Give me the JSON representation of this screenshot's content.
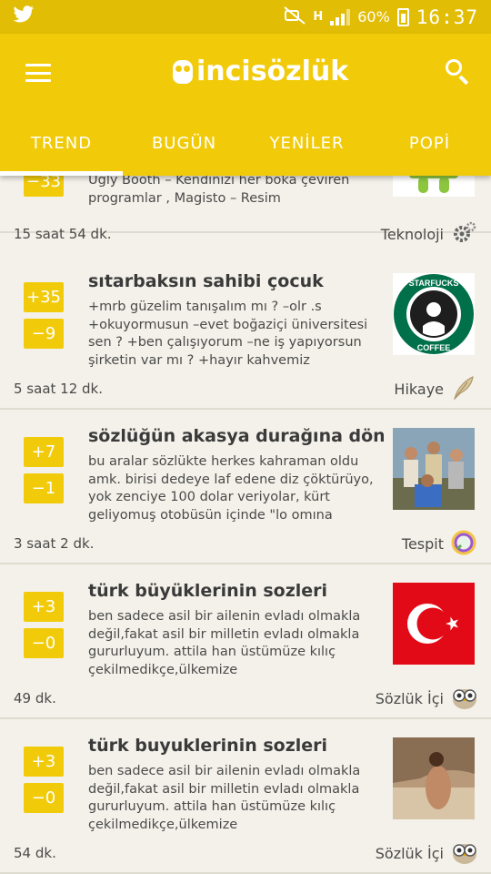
{
  "statusbar": {
    "network": "H",
    "battery": "60%",
    "time": "16:37"
  },
  "app": {
    "logo_text": "incisözlük"
  },
  "tabs": [
    {
      "label": "TREND"
    },
    {
      "label": "BUGÜN"
    },
    {
      "label": "YENİLER"
    },
    {
      "label": "POPİ"
    }
  ],
  "posts": [
    {
      "title": "",
      "body": "Ugly Booth – Kendinizi her boka çeviren programlar , Magisto – Resim",
      "up": "−33",
      "down": "",
      "time": "15 saat 54 dk.",
      "category": "Teknoloji",
      "category_icon": "gear-icon",
      "thumb": "android-robot"
    },
    {
      "title": "sıtarbaksın sahibi çocuk",
      "body": "+mrb güzelim tanışalım mı ? –olr .s +okuyormusun –evet boğaziçi üniversitesi sen ? +ben çalışıyorum –ne iş yapıyorsun şirketin var mı ? +hayır kahvemiz",
      "up": "+35",
      "down": "−9",
      "time": "5 saat 12 dk.",
      "category": "Hikaye",
      "category_icon": "quill-icon",
      "thumb": "starfucks-logo"
    },
    {
      "title": "sözlüğün akasya durağına dönmesi",
      "body": "bu aralar sözlükte herkes kahraman oldu amk. birisi dedeye laf edene diz çöktürüyo, yok zenciye 100 dolar veriyolar, kürt geliyomuş otobüsün içinde \"lo omına",
      "up": "+7",
      "down": "−1",
      "time": "3 saat 2 dk.",
      "category": "Tespit",
      "category_icon": "magnifier-icon",
      "thumb": "group-photo"
    },
    {
      "title": "türk büyüklerinin sozleri",
      "body": "ben sadece asil bir ailenin evladı olmakla değil,fakat asil bir milletin evladı olmakla gururluyum. attila han üstümüze kılıç çekilmedikçe,ülkemize girilmedikçe,tab'ama",
      "up": "+3",
      "down": "−0",
      "time": "49 dk.",
      "category": "Sözlük İçi",
      "category_icon": "owl-icon",
      "thumb": "turkish-flag"
    },
    {
      "title": "türk buyuklerinin sozleri",
      "body": "ben sadece asil bir ailenin evladı olmakla değil,fakat asil bir milletin evladı olmakla gururluyum. attila han üstümüze kılıç çekilmedikçe,ülkemize girilmedikçe,tab'ama",
      "up": "+3",
      "down": "−0",
      "time": "54 dk.",
      "category": "Sözlük İçi",
      "category_icon": "owl-icon",
      "thumb": "beach-photo"
    }
  ]
}
